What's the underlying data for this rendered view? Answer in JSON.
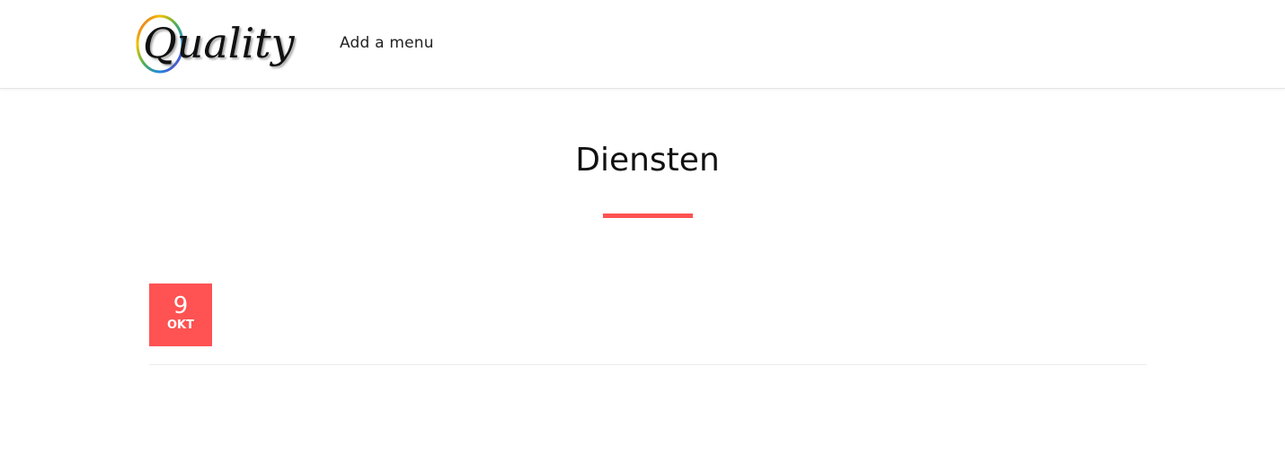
{
  "site": {
    "logo_text": "Quality",
    "colors": {
      "accent": "#ff5252",
      "logo_ring": [
        "#e64a3c",
        "#f2c200",
        "#4caf50",
        "#1e88e5",
        "#8e24aa"
      ]
    }
  },
  "header": {
    "nav_items": [
      {
        "label": "Add a menu"
      }
    ]
  },
  "main": {
    "title": "Diensten",
    "posts": [
      {
        "date": {
          "day": "9",
          "month": "OKT"
        }
      }
    ]
  }
}
